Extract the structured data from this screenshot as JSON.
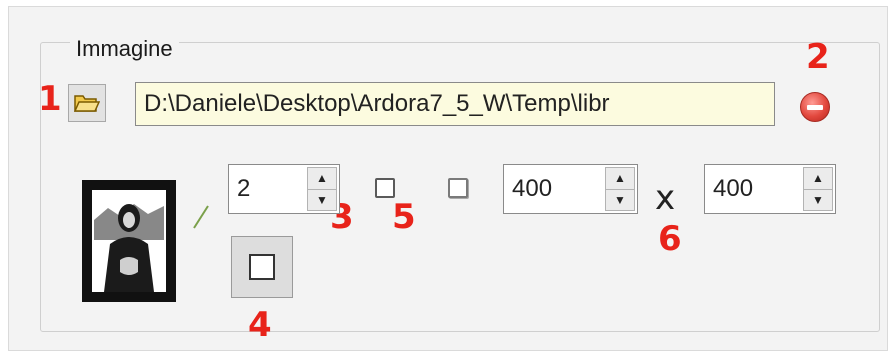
{
  "group": {
    "legend": "Immagine",
    "path_value": "D:\\Daniele\\Desktop\\Ardora7_5_W\\Temp\\libr",
    "border_value": "2",
    "width_value": "400",
    "times_symbol": "x",
    "height_value": "400"
  },
  "callouts": [
    "1",
    "2",
    "3",
    "4",
    "5",
    "6"
  ],
  "icons": {
    "open": "folder-open-icon",
    "remove": "remove-icon",
    "thumbnail": "mona-lisa-thumbnail",
    "up": "▲",
    "down": "▼"
  },
  "colors": {
    "callout": "#e8231a",
    "input_bg": "#fcfbdf",
    "remove": "#e2483e"
  }
}
